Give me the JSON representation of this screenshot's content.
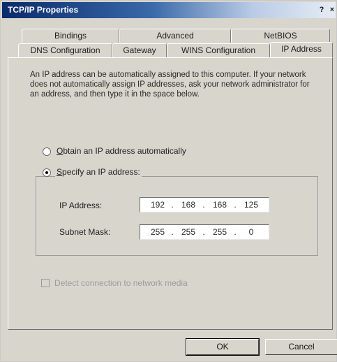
{
  "window": {
    "title": "TCP/IP Properties",
    "help_label": "?",
    "close_label": "×"
  },
  "tabs": {
    "row_back": [
      "Bindings",
      "Advanced",
      "NetBIOS"
    ],
    "row_front": [
      "DNS Configuration",
      "Gateway",
      "WINS Configuration",
      "IP Address"
    ],
    "active": "IP Address"
  },
  "intro_text": "An IP address can be automatically assigned to this computer. If your network does not automatically assign IP addresses, ask your network administrator for an address, and then type it in the space below.",
  "options": {
    "obtain_label": "Obtain an IP address automatically",
    "specify_label": "Specify an IP address:",
    "selected": "specify"
  },
  "ip_address": {
    "label": "IP Address:",
    "octets": [
      "192",
      "168",
      "168",
      "125"
    ]
  },
  "subnet_mask": {
    "label": "Subnet Mask:",
    "octets": [
      "255",
      "255",
      "255",
      "0"
    ]
  },
  "detect": {
    "label": "Detect connection to network media",
    "checked": false,
    "enabled": false
  },
  "buttons": {
    "ok": "OK",
    "cancel": "Cancel"
  }
}
